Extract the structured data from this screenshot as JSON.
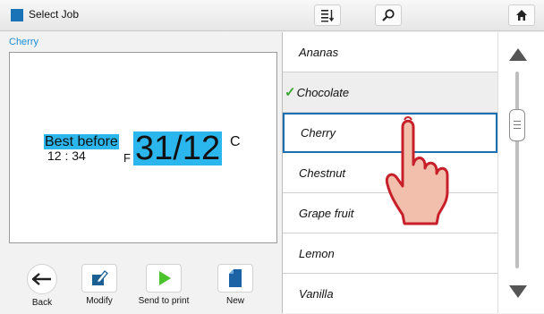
{
  "app": {
    "title": "Select Job"
  },
  "toolbar": {
    "sort_icon": "sort-list-icon",
    "search_icon": "search-icon",
    "home_icon": "home-icon"
  },
  "preview": {
    "selected_name": "Cherry",
    "label_best_before": "Best before",
    "label_time": "12 : 34",
    "label_f": "F",
    "label_date": "31/12",
    "label_c": "C"
  },
  "actions": [
    {
      "label": "Back",
      "icon": "back-arrow-icon"
    },
    {
      "label": "Modify",
      "icon": "edit-icon"
    },
    {
      "label": "Send to print",
      "icon": "play-icon"
    },
    {
      "label": "New",
      "icon": "new-document-icon"
    }
  ],
  "jobs": [
    {
      "name": "Ananas"
    },
    {
      "name": "Chocolate",
      "state": "checked"
    },
    {
      "name": "Cherry",
      "state": "selected"
    },
    {
      "name": "Chestnut"
    },
    {
      "name": "Grape fruit"
    },
    {
      "name": "Lemon"
    },
    {
      "name": "Vanilla"
    }
  ],
  "colors": {
    "accent": "#1a73b7",
    "highlight": "#2bb6ee",
    "check": "#3aa832",
    "hand_fill": "#f2bfad",
    "hand_outline": "#c8202a"
  }
}
